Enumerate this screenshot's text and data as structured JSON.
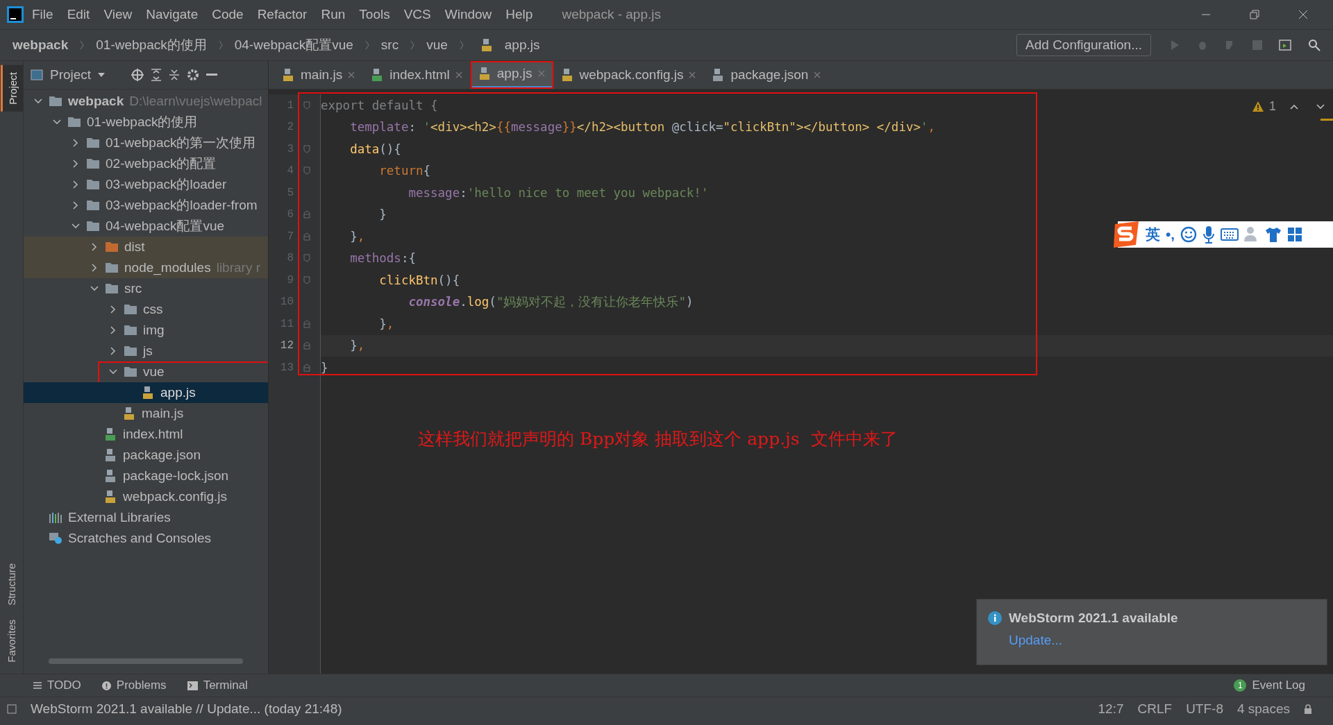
{
  "window": {
    "title": "webpack - app.js"
  },
  "menu": [
    "File",
    "Edit",
    "View",
    "Navigate",
    "Code",
    "Refactor",
    "Run",
    "Tools",
    "VCS",
    "Window",
    "Help"
  ],
  "breadcrumbs": [
    {
      "label": "webpack",
      "kind": "project"
    },
    {
      "label": "01-webpack的使用",
      "kind": "folder"
    },
    {
      "label": "04-webpack配置vue",
      "kind": "folder"
    },
    {
      "label": "src",
      "kind": "folder"
    },
    {
      "label": "vue",
      "kind": "folder"
    },
    {
      "label": "app.js",
      "kind": "js"
    }
  ],
  "run_config": {
    "label": "Add Configuration..."
  },
  "side_stripe": {
    "top": [
      {
        "label": "Project",
        "selected": true
      }
    ],
    "bottom": [
      {
        "label": "Structure",
        "selected": false
      },
      {
        "label": "Favorites",
        "selected": false
      }
    ]
  },
  "project_panel": {
    "title": "Project",
    "tree": [
      {
        "label": "webpack",
        "hint": "D:\\learn\\vuejs\\webpacl",
        "kind": "folder",
        "expanded": true,
        "selected": false,
        "boxed": false,
        "children": [
          {
            "label": "01-webpack的使用",
            "kind": "folder",
            "expanded": true,
            "selected": false,
            "boxed": false,
            "children": [
              {
                "label": "01-webpack的第一次使用",
                "kind": "folder",
                "expanded": false,
                "selected": false,
                "boxed": false
              },
              {
                "label": "02-webpack的配置",
                "kind": "folder",
                "expanded": false,
                "selected": false,
                "boxed": false
              },
              {
                "label": "03-webpack的loader",
                "kind": "folder",
                "expanded": false,
                "selected": false,
                "boxed": false
              },
              {
                "label": "03-webpack的loader-from",
                "kind": "folder",
                "expanded": false,
                "selected": false,
                "boxed": false
              },
              {
                "label": "04-webpack配置vue",
                "kind": "folder",
                "expanded": true,
                "selected": false,
                "boxed": false,
                "children": [
                  {
                    "label": "dist",
                    "kind": "output-folder",
                    "expanded": false,
                    "selected": false,
                    "boxed": false
                  },
                  {
                    "label": "node_modules",
                    "hint": "library r",
                    "kind": "excluded-folder",
                    "expanded": false,
                    "selected": false,
                    "boxed": false
                  },
                  {
                    "label": "src",
                    "kind": "folder",
                    "expanded": true,
                    "selected": false,
                    "boxed": false,
                    "children": [
                      {
                        "label": "css",
                        "kind": "folder",
                        "expanded": false,
                        "selected": false,
                        "boxed": false
                      },
                      {
                        "label": "img",
                        "kind": "folder",
                        "expanded": false,
                        "selected": false,
                        "boxed": false
                      },
                      {
                        "label": "js",
                        "kind": "folder",
                        "expanded": false,
                        "selected": false,
                        "boxed": false
                      },
                      {
                        "label": "vue",
                        "kind": "folder",
                        "expanded": true,
                        "selected": false,
                        "boxed": true,
                        "children": [
                          {
                            "label": "app.js",
                            "kind": "js",
                            "selected": true,
                            "boxed": false
                          }
                        ]
                      },
                      {
                        "label": "main.js",
                        "kind": "js",
                        "selected": false,
                        "boxed": false
                      }
                    ]
                  },
                  {
                    "label": "index.html",
                    "kind": "html",
                    "selected": false,
                    "boxed": false
                  },
                  {
                    "label": "package.json",
                    "kind": "json",
                    "selected": false,
                    "boxed": false
                  },
                  {
                    "label": "package-lock.json",
                    "kind": "json",
                    "selected": false,
                    "boxed": false
                  },
                  {
                    "label": "webpack.config.js",
                    "kind": "js",
                    "selected": false,
                    "boxed": false
                  }
                ]
              }
            ]
          }
        ]
      },
      {
        "label": "External Libraries",
        "kind": "library",
        "selected": false,
        "boxed": false
      },
      {
        "label": "Scratches and Consoles",
        "kind": "scratches",
        "selected": false,
        "boxed": false
      }
    ]
  },
  "tabs": [
    {
      "label": "main.js",
      "kind": "js",
      "selected": false,
      "boxed": false
    },
    {
      "label": "index.html",
      "kind": "html",
      "selected": false,
      "boxed": false
    },
    {
      "label": "app.js",
      "kind": "js",
      "selected": true,
      "boxed": true
    },
    {
      "label": "webpack.config.js",
      "kind": "js",
      "selected": false,
      "boxed": false
    },
    {
      "label": "package.json",
      "kind": "json",
      "selected": false,
      "boxed": false
    }
  ],
  "editor": {
    "warnings": "1",
    "boxed": true,
    "lines": [
      {
        "number": "1",
        "current": false,
        "fold_open": true,
        "fold_close": false,
        "tokens": [
          {
            "t": "export default {",
            "kind": "dim"
          }
        ]
      },
      {
        "number": "2",
        "current": false,
        "fold_open": false,
        "fold_close": false,
        "tokens": [
          {
            "t": "    template",
            "kind": "prop"
          },
          {
            "t": ": ",
            "kind": "plain"
          },
          {
            "t": "'",
            "kind": "str"
          },
          {
            "t": "<div><h2>",
            "kind": "html"
          },
          {
            "t": "{{",
            "kind": "kw"
          },
          {
            "t": "message",
            "kind": "prop"
          },
          {
            "t": "}}",
            "kind": "kw"
          },
          {
            "t": "</h2><button ",
            "kind": "html"
          },
          {
            "t": "@click=",
            "kind": "plain"
          },
          {
            "t": "\"clickBtn\"",
            "kind": "html"
          },
          {
            "t": "></button> </div>",
            "kind": "html"
          },
          {
            "t": "'",
            "kind": "str"
          },
          {
            "t": ",",
            "kind": "kw"
          }
        ]
      },
      {
        "number": "3",
        "current": false,
        "fold_open": true,
        "fold_close": false,
        "tokens": [
          {
            "t": "    data",
            "kind": "fn"
          },
          {
            "t": "(){",
            "kind": "plain"
          }
        ]
      },
      {
        "number": "4",
        "current": false,
        "fold_open": true,
        "fold_close": false,
        "tokens": [
          {
            "t": "        return",
            "kind": "kw"
          },
          {
            "t": "{",
            "kind": "plain"
          }
        ]
      },
      {
        "number": "5",
        "current": false,
        "fold_open": false,
        "fold_close": false,
        "tokens": [
          {
            "t": "            message",
            "kind": "prop"
          },
          {
            "t": ":",
            "kind": "plain"
          },
          {
            "t": "'hello nice to meet you webpack!'",
            "kind": "str"
          }
        ]
      },
      {
        "number": "6",
        "current": false,
        "fold_open": false,
        "fold_close": true,
        "tokens": [
          {
            "t": "        }",
            "kind": "plain"
          }
        ]
      },
      {
        "number": "7",
        "current": false,
        "fold_open": false,
        "fold_close": true,
        "tokens": [
          {
            "t": "    }",
            "kind": "plain"
          },
          {
            "t": ",",
            "kind": "kw"
          }
        ]
      },
      {
        "number": "8",
        "current": false,
        "fold_open": true,
        "fold_close": false,
        "tokens": [
          {
            "t": "    methods",
            "kind": "prop"
          },
          {
            "t": ":{",
            "kind": "plain"
          }
        ]
      },
      {
        "number": "9",
        "current": false,
        "fold_open": true,
        "fold_close": false,
        "tokens": [
          {
            "t": "        clickBtn",
            "kind": "fn"
          },
          {
            "t": "(){",
            "kind": "plain"
          }
        ]
      },
      {
        "number": "10",
        "current": false,
        "fold_open": false,
        "fold_close": false,
        "tokens": [
          {
            "t": "            console",
            "kind": "obj"
          },
          {
            "t": ".",
            "kind": "plain"
          },
          {
            "t": "log",
            "kind": "fn"
          },
          {
            "t": "(",
            "kind": "plain"
          },
          {
            "t": "\"妈妈对不起，没有让你老年快乐\"",
            "kind": "str"
          },
          {
            "t": ")",
            "kind": "plain"
          }
        ]
      },
      {
        "number": "11",
        "current": false,
        "fold_open": false,
        "fold_close": true,
        "tokens": [
          {
            "t": "        }",
            "kind": "plain"
          },
          {
            "t": ",",
            "kind": "kw"
          }
        ]
      },
      {
        "number": "12",
        "current": true,
        "fold_open": false,
        "fold_close": true,
        "tokens": [
          {
            "t": "    }",
            "kind": "plain"
          },
          {
            "t": ",",
            "kind": "kw"
          }
        ]
      },
      {
        "number": "13",
        "current": false,
        "fold_open": false,
        "fold_close": true,
        "tokens": [
          {
            "t": "}",
            "kind": "plain"
          }
        ]
      }
    ]
  },
  "annotation": "这样我们就把声明的 Bpp对象 抽取到这个 app.js  文件中来了",
  "ime_toolbar": {
    "mode": "英",
    "punct": "•,"
  },
  "notification": {
    "title": "WebStorm 2021.1 available",
    "link": "Update..."
  },
  "bottom_tools": [
    {
      "label": "TODO",
      "kind": "todo"
    },
    {
      "label": "Problems",
      "kind": "problems"
    },
    {
      "label": "Terminal",
      "kind": "terminal"
    }
  ],
  "event_log": {
    "label": "Event Log",
    "count": "1"
  },
  "status_bar": {
    "message": "WebStorm 2021.1 available // Update... (today 21:48)",
    "items": [
      "12:7",
      "CRLF",
      "UTF-8",
      "4 spaces"
    ]
  }
}
